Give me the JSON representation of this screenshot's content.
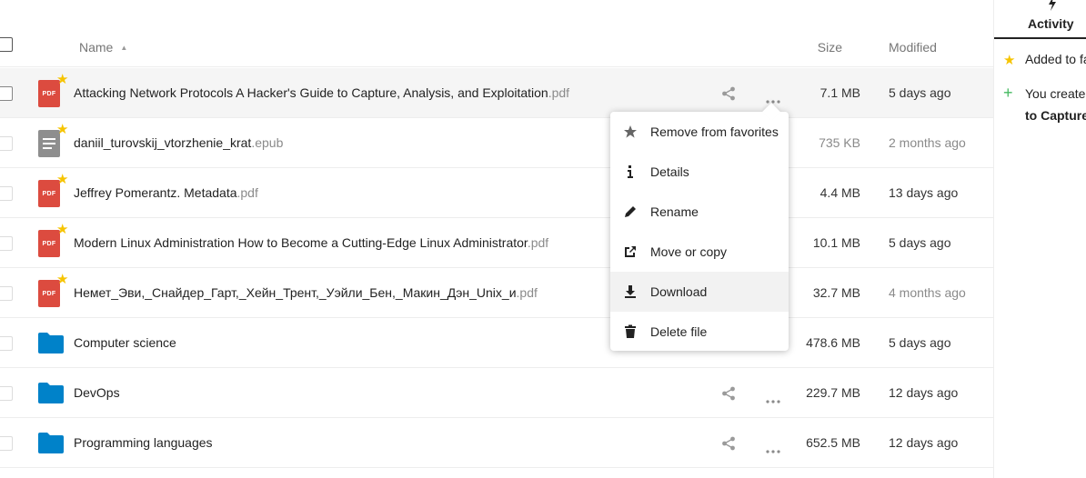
{
  "header": {
    "name_label": "Name",
    "size_label": "Size",
    "modified_label": "Modified"
  },
  "files": [
    {
      "name": "Attacking Network Protocols A Hacker's Guide to Capture, Analysis, and Exploitation",
      "ext": ".pdf",
      "type": "pdf",
      "favorite": true,
      "size": "7.1 MB",
      "modified": "5 days ago",
      "selected": true
    },
    {
      "name": "daniil_turovskij_vtorzhenie_krat",
      "ext": ".epub",
      "type": "doc",
      "favorite": true,
      "size": "735 KB",
      "modified": "2 months ago",
      "selected": false
    },
    {
      "name": "Jeffrey Pomerantz. Metadata",
      "ext": ".pdf",
      "type": "pdf",
      "favorite": true,
      "size": "4.4 MB",
      "modified": "13 days ago",
      "selected": false
    },
    {
      "name": "Modern Linux Administration How to Become a Cutting-Edge Linux Administrator",
      "ext": ".pdf",
      "type": "pdf",
      "favorite": true,
      "size": "10.1 MB",
      "modified": "5 days ago",
      "selected": false
    },
    {
      "name": "Немет_Эви,_Снайдер_Гарт,_Хейн_Трент,_Уэйли_Бен,_Макин_Дэн_Unix_и",
      "ext": ".pdf",
      "type": "pdf",
      "favorite": true,
      "size": "32.7 MB",
      "modified": "4 months ago",
      "selected": false
    },
    {
      "name": "Computer science",
      "ext": "",
      "type": "folder",
      "favorite": false,
      "size": "478.6 MB",
      "modified": "5 days ago",
      "selected": false
    },
    {
      "name": "DevOps",
      "ext": "",
      "type": "folder",
      "favorite": false,
      "size": "229.7 MB",
      "modified": "12 days ago",
      "selected": false
    },
    {
      "name": "Programming languages",
      "ext": "",
      "type": "folder",
      "favorite": false,
      "size": "652.5 MB",
      "modified": "12 days ago",
      "selected": false
    }
  ],
  "pdf_badge": "PDF",
  "context_menu": {
    "items": [
      {
        "label": "Remove from favorites",
        "icon": "star-icon"
      },
      {
        "label": "Details",
        "icon": "info-icon"
      },
      {
        "label": "Rename",
        "icon": "pencil-icon"
      },
      {
        "label": "Move or copy",
        "icon": "external-link-icon"
      },
      {
        "label": "Download",
        "icon": "download-icon"
      },
      {
        "label": "Delete file",
        "icon": "trash-icon"
      }
    ],
    "hovered": "Download"
  },
  "sidebar": {
    "tab_label": "Activity",
    "entries": [
      {
        "icon": "star-icon",
        "text": "Added to fa"
      },
      {
        "icon": "plus-icon",
        "text": "You created",
        "bold": "to Capture"
      }
    ]
  },
  "colors": {
    "pdf": "#dc4b3f",
    "folder": "#0082c9",
    "star": "#f6c400",
    "plus": "#46ba61"
  }
}
